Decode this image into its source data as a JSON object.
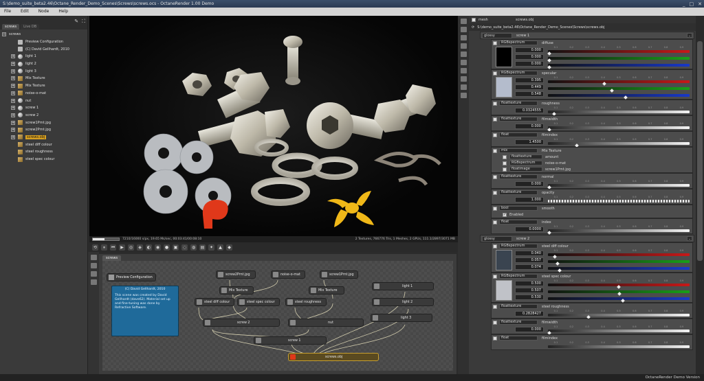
{
  "window": {
    "title": "S:\\demo_suite_beta2.46\\Octane_Render_Demo_Scenes\\Screws\\screws.ocs - OctaneRender 1.00 Demo",
    "controls": [
      "_",
      "□",
      "✕"
    ]
  },
  "menu": [
    "File",
    "Edit",
    "Node",
    "Help"
  ],
  "outliner": {
    "tabs": [
      "screws",
      "Live DB"
    ],
    "items": [
      {
        "label": "screws",
        "kind": "root"
      },
      {
        "label": "Preview Configuration",
        "kind": "cfg"
      },
      {
        "label": "(C) David Gellhardt, 2010",
        "kind": "cfg"
      },
      {
        "label": "light 1",
        "kind": "sphere"
      },
      {
        "label": "light 2",
        "kind": "sphere"
      },
      {
        "label": "light 3",
        "kind": "sphere"
      },
      {
        "label": "Mix Texture",
        "kind": "tex"
      },
      {
        "label": "Mix Texture",
        "kind": "tex"
      },
      {
        "label": "noise-o-mat",
        "kind": "tex"
      },
      {
        "label": "nut",
        "kind": "sphere"
      },
      {
        "label": "screw 1",
        "kind": "sphere"
      },
      {
        "label": "screw 2",
        "kind": "sphere"
      },
      {
        "label": "screw1Prnt.jpg",
        "kind": "tex"
      },
      {
        "label": "screw2Prnt.jpg",
        "kind": "tex"
      },
      {
        "label": "screws.obj",
        "kind": "tex",
        "selected": true
      },
      {
        "label": "steel diff colour",
        "kind": "tex"
      },
      {
        "label": "steel roughness",
        "kind": "tex"
      },
      {
        "label": "steel spec colour",
        "kind": "tex"
      }
    ]
  },
  "viewport": {
    "status_left": "7210/16000 s/px, 19.65 Ms/sec, 00:03:41/00:08:10",
    "status_right": "2 Textures, 766776 Tris, 1 Meshes, 2 GPUs, 111.1/2897/3071 MB",
    "render_progress": 0.45
  },
  "graph": {
    "tab": "screws",
    "preview_config": "Preview Configuration",
    "note_title": "(C) David Gellhardt, 2010",
    "note_body": "This scene was created by David Gellhardt (dave62). Material set up and fine-tuning was done by Refractive Software.",
    "nodes": {
      "screw2prnt": "screw2Prnt.jpg",
      "noise": "noise-o-mat",
      "screw1prnt": "screw1Prnt.jpg",
      "mix1": "Mix Texture",
      "mix2": "Mix Texture",
      "steel_diff": "steel diff colour",
      "steel_spec": "steel spec colour",
      "steel_rough": "steel roughness",
      "light1": "light 1",
      "light2": "light 2",
      "light3": "light 3",
      "screw2": "screw 2",
      "nut": "nut",
      "screw1": "screw 1",
      "screws_obj": "screws.obj"
    }
  },
  "inspector": {
    "header_type": "mesh",
    "header_name": "screws.obj",
    "path": "S:\\demo_suite_beta2.46\\Octane_Render_Demo_Scenes\\Screws\\screws.obj",
    "groups": [
      {
        "type": "glossy",
        "name": "screw 1"
      },
      {
        "type": "glossy",
        "name": "screw 2"
      }
    ],
    "g1": {
      "diffuse": {
        "type": "RGBspectrum",
        "name": "diffuse",
        "r": "0.000",
        "g": "0.000",
        "b": "0.000",
        "color": "#000000"
      },
      "specular": {
        "type": "RGBspectrum",
        "name": "specular",
        "r": "0.395",
        "g": "0.449",
        "b": "0.548",
        "color": "#b4bccc"
      },
      "roughness": {
        "type": "floattexture",
        "name": "roughness",
        "value": "0.0324555"
      },
      "filmwidth": {
        "type": "floattexture",
        "name": "filmwidth",
        "value": "0.000"
      },
      "filmindex": {
        "type": "float",
        "name": "filmindex",
        "value": "1.4500"
      },
      "bump": {
        "type": "mix",
        "name": "Mix Texture",
        "subs": [
          {
            "type": "floattexture",
            "name": "amount"
          },
          {
            "type": "RGBspectrum",
            "name": "noise-o-mat"
          },
          {
            "type": "floatimage",
            "name": "screw1Prnt.jpg"
          }
        ]
      },
      "normal": {
        "type": "floattexture",
        "name": "normal",
        "value": "0.000"
      },
      "opacity": {
        "type": "floattexture",
        "name": "opacity",
        "value": "1.000"
      },
      "smooth": {
        "type": "bool",
        "name": "smooth",
        "check_label": "Enabled"
      },
      "index": {
        "type": "float",
        "name": "index",
        "value": "0.0000"
      }
    },
    "g2": {
      "diffuse": {
        "type": "RGBspectrum",
        "name": "steel diff colour",
        "r": "0.040",
        "g": "0.057",
        "b": "0.074",
        "color": "#3a4450"
      },
      "specular": {
        "type": "RGBspectrum",
        "name": "steel spec colour",
        "r": "0.500",
        "g": "0.507",
        "b": "0.530",
        "color": "#c0c2c8"
      },
      "roughness": {
        "type": "floattexture",
        "name": "steel roughness",
        "value": "0.2828427"
      },
      "filmwidth": {
        "type": "floattexture",
        "name": "filmwidth",
        "value": "0.000"
      },
      "filmindex": {
        "type": "float",
        "name": "filmindex"
      }
    },
    "ticks": [
      "0.1",
      "0.2",
      "0.3",
      "0.4",
      "0.5",
      "0.6",
      "0.7",
      "0.8",
      "0.9"
    ]
  },
  "statusbar": "OctaneRender Demo Version",
  "colors": {
    "accent": "#d8a020",
    "note": "#1f6a9a",
    "red": "#c81818",
    "green": "#18a018",
    "blue": "#1838c8"
  }
}
